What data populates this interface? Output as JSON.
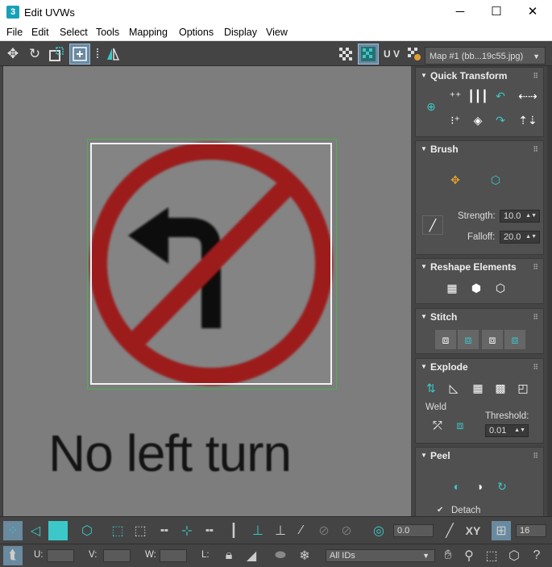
{
  "window": {
    "app_icon": "3",
    "title": "Edit UVWs",
    "minimize": "─",
    "maximize": "☐",
    "close": "✕"
  },
  "menu": [
    "File",
    "Edit",
    "Select",
    "Tools",
    "Mapping",
    "Options",
    "Display",
    "View"
  ],
  "toolbar": {
    "uv_label": "U V",
    "map_select": "Map #1 (bb...19c55.jpg)"
  },
  "viewport": {
    "texture_text": "No left turn",
    "colors": {
      "sign_red": "#9c1d1d",
      "arrow": "#111111",
      "uv_border": "#4caf50"
    }
  },
  "panel": {
    "quick_transform": {
      "title": "Quick Transform"
    },
    "brush": {
      "title": "Brush",
      "strength_label": "Strength:",
      "strength": "10.0",
      "falloff_label": "Falloff:",
      "falloff": "20.0"
    },
    "reshape": {
      "title": "Reshape Elements"
    },
    "stitch": {
      "title": "Stitch"
    },
    "explode": {
      "title": "Explode",
      "weld_label": "Weld",
      "threshold_label": "Threshold:",
      "threshold": "0.01"
    },
    "peel": {
      "title": "Peel",
      "detach_label": "Detach",
      "detach_checked": true
    }
  },
  "bottom": {
    "angle_value": "0.0",
    "xy_label": "XY",
    "count_value": "16",
    "u_label": "U:",
    "v_label": "V:",
    "w_label": "W:",
    "l_label": "L:",
    "ids_select": "All IDs"
  },
  "accent_color": "#3cc8c8"
}
